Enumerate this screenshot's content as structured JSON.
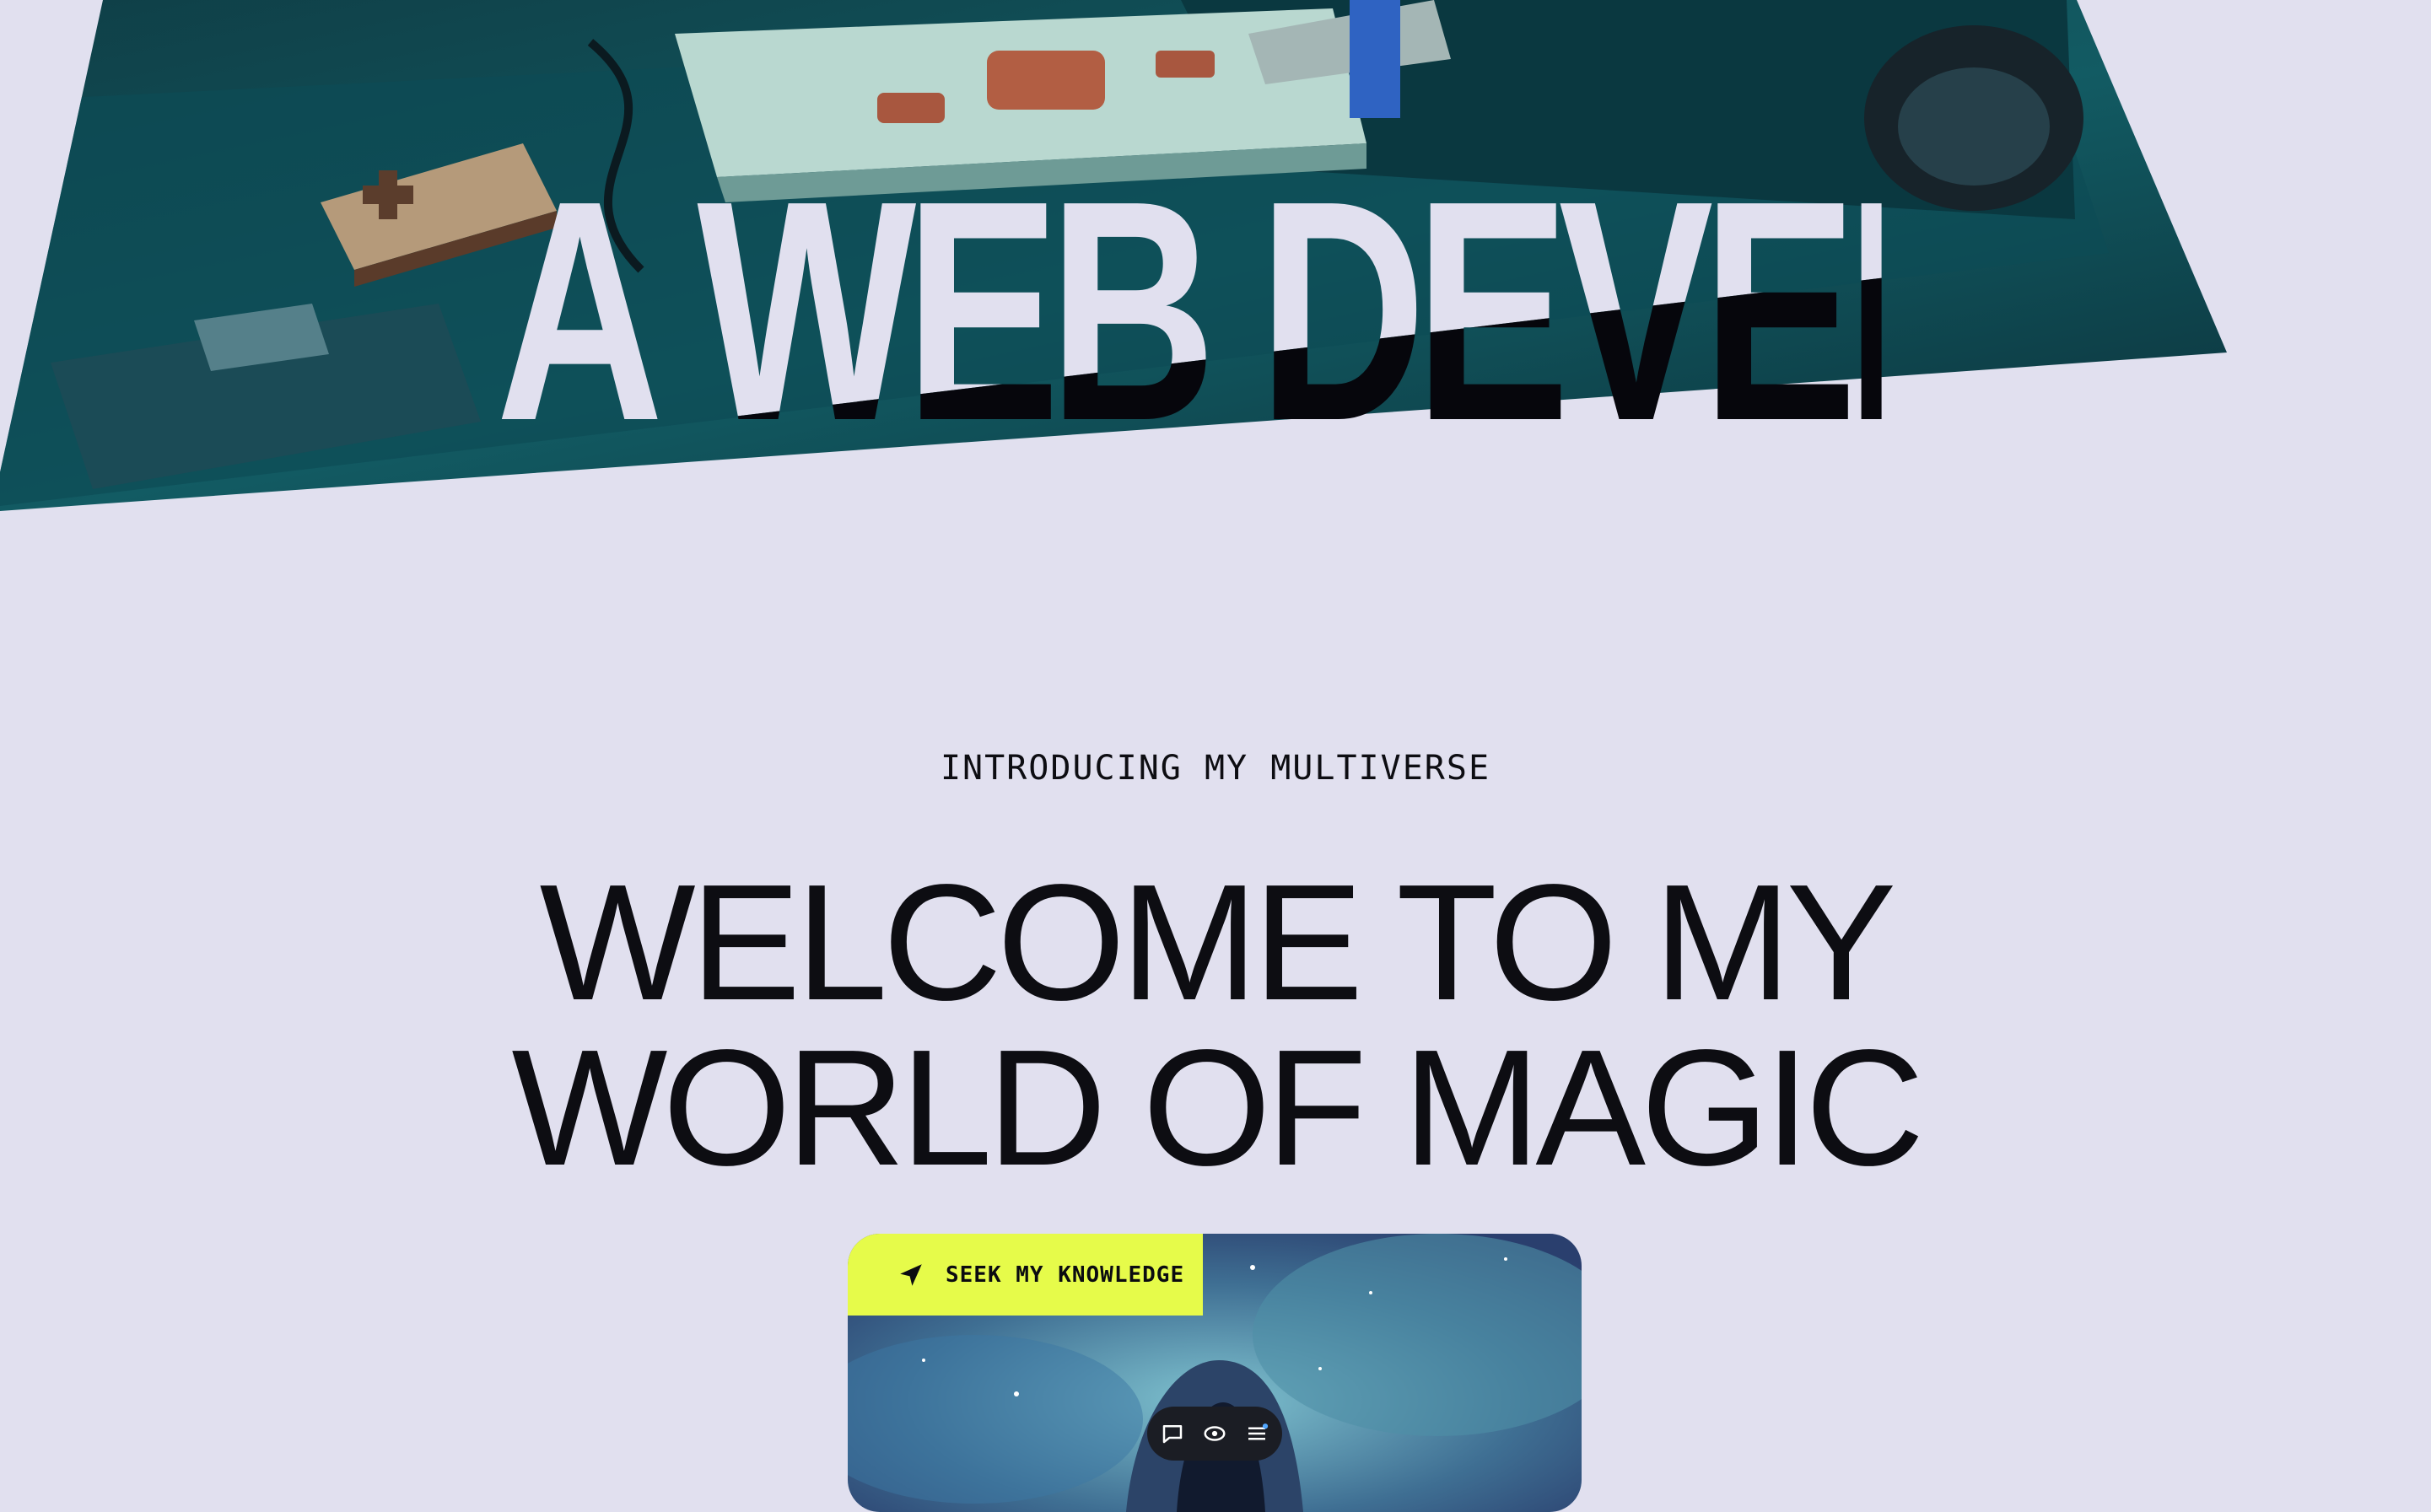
{
  "hero": {
    "title": "A WEB DEVELOPER",
    "image_icon": "retro-game-console-image"
  },
  "intro": {
    "eyebrow": "INTRODUCING MY MULTIVERSE",
    "headline_line1": "WELCOME TO MY",
    "headline_line2": "WORLD OF MAGIC"
  },
  "card": {
    "button_label": "SEEK MY KNOWLEDGE",
    "button_icon": "navigation-arrow-icon",
    "accent_color": "#e6fb4a",
    "image_icon": "hooded-wizard-image"
  },
  "toolbar": {
    "items": [
      {
        "icon": "chat-bubble-icon"
      },
      {
        "icon": "eye-icon"
      },
      {
        "icon": "menu-icon"
      }
    ]
  },
  "colors": {
    "background": "#e1e0ef",
    "text": "#0d0d12"
  }
}
